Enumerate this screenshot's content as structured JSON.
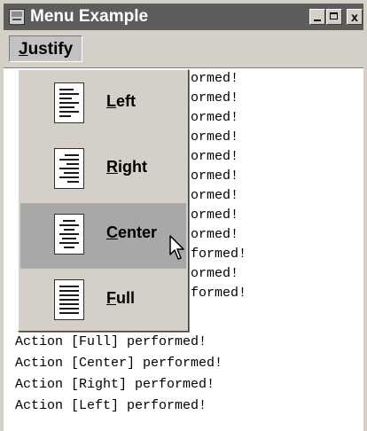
{
  "window": {
    "title": "Menu Example",
    "close_glyph": "x",
    "app_icon": "app-window-icon"
  },
  "menubar": {
    "justify": {
      "mnemonic": "J",
      "rest": "ustify"
    }
  },
  "popup_menu": {
    "items": [
      {
        "mnemonic": "L",
        "rest": "eft",
        "icon": "align-left-icon",
        "selected": false
      },
      {
        "mnemonic": "R",
        "rest": "ight",
        "icon": "align-right-icon",
        "selected": false
      },
      {
        "mnemonic": "C",
        "rest": "enter",
        "icon": "align-center-icon",
        "selected": true
      },
      {
        "mnemonic": "F",
        "rest": "ull",
        "icon": "align-justify-icon",
        "selected": false
      }
    ]
  },
  "log": {
    "hidden_lines": [
      "rformed!",
      "formed!",
      "formed!",
      "rformed!",
      "rformed!",
      "formed!",
      "formed!",
      "rformed!",
      "formed!",
      "erformed!",
      "formed!",
      "erformed!"
    ],
    "visible_lines": [
      "Action [Full] performed!",
      "Action [Center] performed!",
      "Action [Right] performed!",
      "Action [Left] performed!"
    ]
  },
  "colors": {
    "titlebar": "#5d5d5d",
    "window_bg": "#d4d0c8",
    "selected_item": "#a8a8a8",
    "content_bg": "#ffffff"
  }
}
